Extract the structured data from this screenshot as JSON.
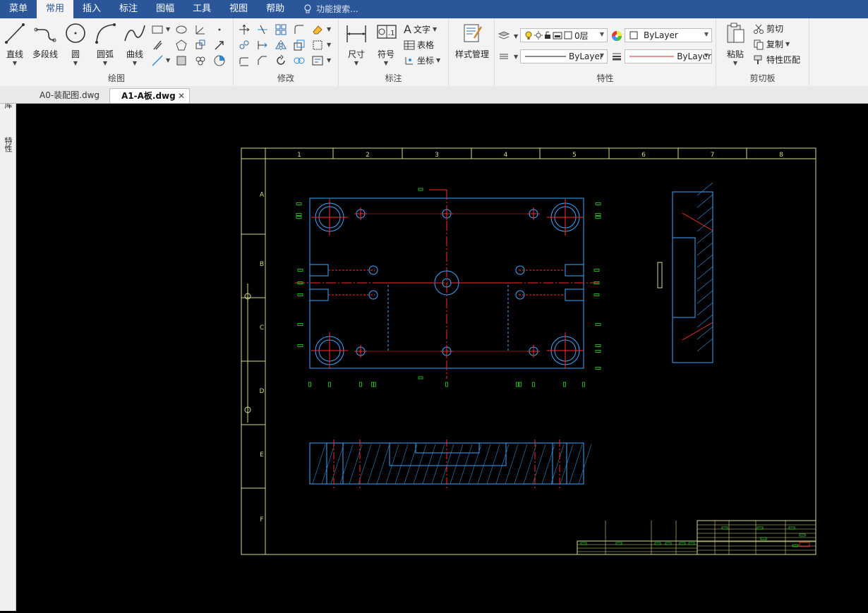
{
  "menu": {
    "items": [
      "菜单",
      "常用",
      "插入",
      "标注",
      "图幅",
      "工具",
      "视图",
      "帮助"
    ],
    "active_index": 1,
    "search_placeholder": "功能搜索..."
  },
  "ribbon": {
    "draw": {
      "label": "绘图",
      "line": "直线",
      "polyline": "多段线",
      "circle": "圆",
      "arc": "圆弧",
      "curve": "曲线"
    },
    "modify": {
      "label": "修改"
    },
    "annotate": {
      "label": "标注",
      "dimension": "尺寸",
      "symbol": "符号",
      "text": "文字",
      "table": "表格",
      "coordinate": "坐标"
    },
    "style": {
      "label": "样式管理"
    },
    "properties": {
      "label": "特性",
      "layer": "0层",
      "color": "ByLayer",
      "linetype": "ByLayer",
      "lineweight": "ByLayer"
    },
    "clipboard": {
      "label": "剪切板",
      "paste": "粘贴",
      "cut": "剪切",
      "copy": "复制",
      "match": "特性匹配"
    }
  },
  "tabs": [
    {
      "label": "A0-装配图.dwg",
      "active": false
    },
    {
      "label": "A1-A板.dwg",
      "active": true
    }
  ],
  "side_panel": {
    "library": "图库",
    "properties": "特性"
  },
  "drawing": {
    "col_labels": [
      "1",
      "2",
      "3",
      "4",
      "5",
      "6",
      "7",
      "8"
    ],
    "row_labels": [
      "A",
      "B",
      "C",
      "D",
      "E",
      "F"
    ],
    "colors": {
      "frame": "#d8d88a",
      "part": "#3aa8ff",
      "center": "#ff2a2a",
      "dim": "#22dd22",
      "hatch": "#2a8acc"
    }
  }
}
